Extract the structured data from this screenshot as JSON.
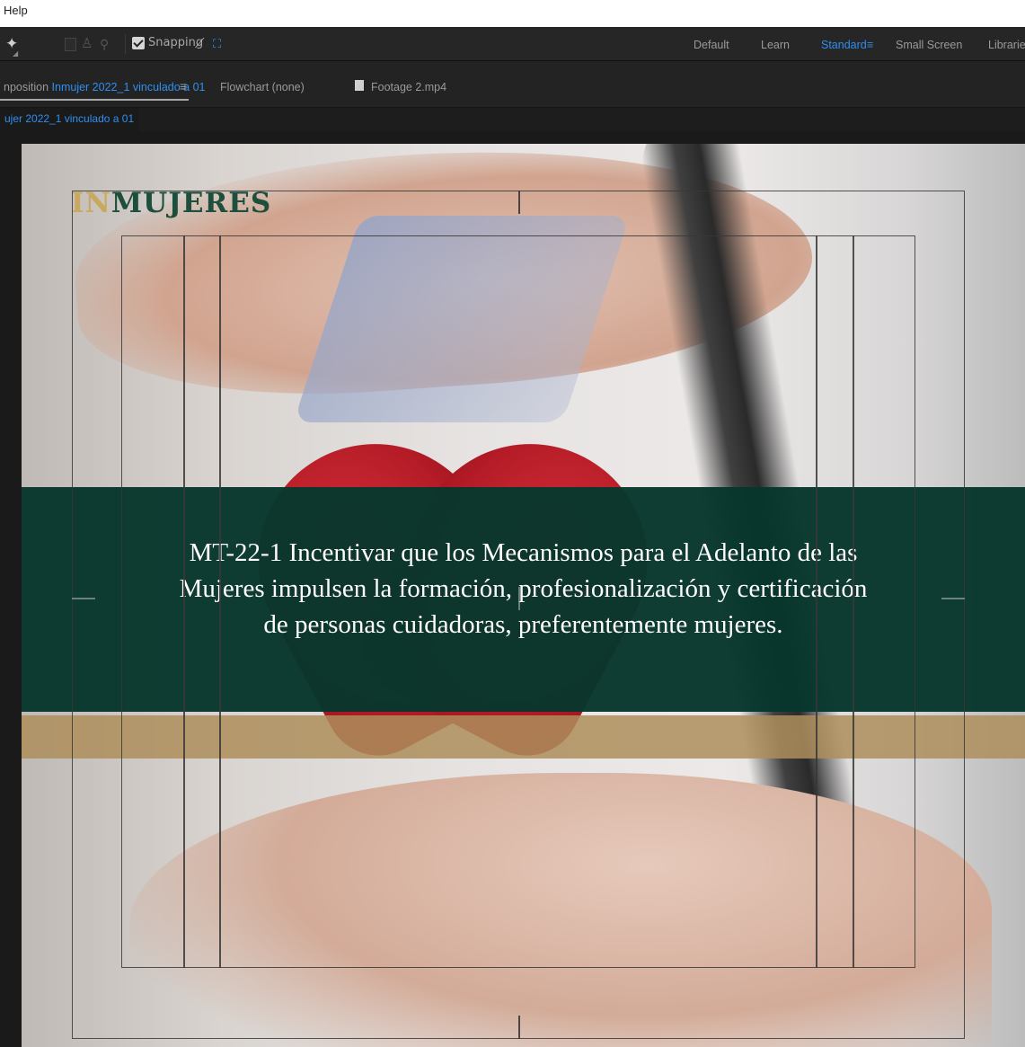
{
  "menubar": {
    "help_label": "Help"
  },
  "toolbar": {
    "snapping_label": "Snapping",
    "snapping_checked": true,
    "workspaces": [
      {
        "label": "Default",
        "active": false
      },
      {
        "label": "Learn",
        "active": false
      },
      {
        "label": "Standard",
        "active": true
      },
      {
        "label": "Small Screen",
        "active": false
      },
      {
        "label": "Libraries",
        "active": false
      }
    ]
  },
  "panel_tabs": {
    "composition_prefix": "nposition",
    "composition_name": "Inmujer 2022_1 vinculado a 01",
    "flowchart_label": "Flowchart (none)",
    "footage_label": "Footage 2.mp4"
  },
  "comp_subtab": {
    "label": "ujer 2022_1 vinculado a 01"
  },
  "composition": {
    "logo_prefix": "IN",
    "logo_text": "MUJERES",
    "headline_lines": [
      "MT-22-1 Incentivar que los Mecanismos para el Adelanto de las",
      "Mujeres impulsen la formación, profesionalización y certificación",
      "de personas cuidadoras, preferentemente mujeres."
    ]
  },
  "colors": {
    "accent_blue": "#2f8ff0",
    "band_green": "#07372c",
    "band_gold": "#ae8e5c",
    "logo_green": "#1e4f3d",
    "logo_gold": "#c9a860"
  },
  "icons": [
    "pin-tool-icon",
    "shape-tool-icon",
    "puppet-pin-icon",
    "snapping-checkbox-icon",
    "snap-edges-icon",
    "snap-frame-icon",
    "panel-menu-icon",
    "workspace-menu-icon",
    "footage-swatch-icon"
  ]
}
